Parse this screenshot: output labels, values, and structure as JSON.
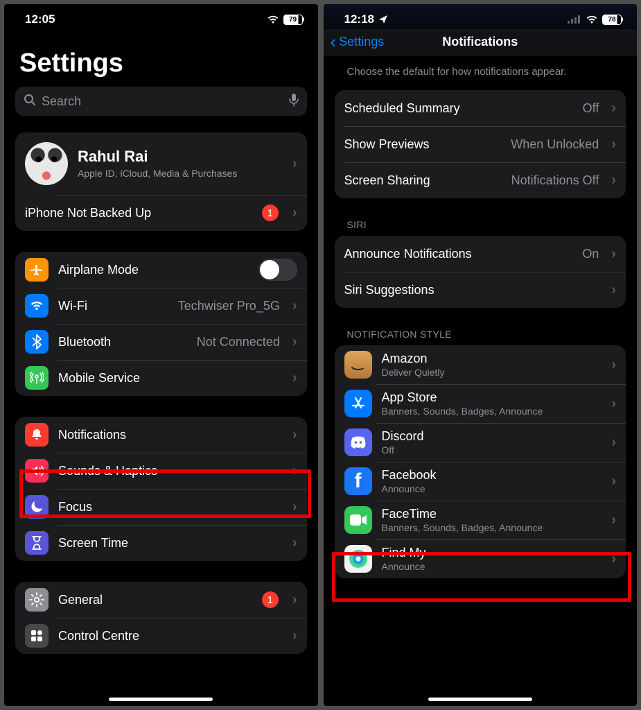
{
  "left": {
    "status": {
      "time": "12:05",
      "battery": "79"
    },
    "title": "Settings",
    "search_placeholder": "Search",
    "profile": {
      "name": "Rahul Rai",
      "subtitle": "Apple ID, iCloud, Media & Purchases"
    },
    "backup": {
      "label": "iPhone Not Backed Up",
      "badge": "1"
    },
    "group1": [
      {
        "icon": "airplane",
        "label": "Airplane Mode",
        "toggle": true
      },
      {
        "icon": "wifi",
        "label": "Wi-Fi",
        "detail": "Techwiser Pro_5G"
      },
      {
        "icon": "bluetooth",
        "label": "Bluetooth",
        "detail": "Not Connected"
      },
      {
        "icon": "antenna",
        "label": "Mobile Service",
        "detail": ""
      }
    ],
    "group2": [
      {
        "icon": "bell",
        "label": "Notifications"
      },
      {
        "icon": "speaker",
        "label": "Sounds & Haptics"
      },
      {
        "icon": "moon",
        "label": "Focus"
      },
      {
        "icon": "hourglass",
        "label": "Screen Time"
      }
    ],
    "group3": [
      {
        "icon": "gear",
        "label": "General",
        "badge": "1"
      },
      {
        "icon": "cc",
        "label": "Control Centre"
      }
    ]
  },
  "right": {
    "status": {
      "time": "12:18",
      "battery": "78"
    },
    "back": "Settings",
    "title": "Notifications",
    "desc": "Choose the default for how notifications appear.",
    "opts": [
      {
        "label": "Scheduled Summary",
        "detail": "Off"
      },
      {
        "label": "Show Previews",
        "detail": "When Unlocked"
      },
      {
        "label": "Screen Sharing",
        "detail": "Notifications Off"
      }
    ],
    "siri_header": "SIRI",
    "siri": [
      {
        "label": "Announce Notifications",
        "detail": "On"
      },
      {
        "label": "Siri Suggestions",
        "detail": ""
      }
    ],
    "style_header": "NOTIFICATION STYLE",
    "apps": [
      {
        "name": "Amazon",
        "sub": "Deliver Quietly",
        "bg": "bg-amazon",
        "glyph": ""
      },
      {
        "name": "App Store",
        "sub": "Banners, Sounds, Badges, Announce",
        "bg": "bg-blue",
        "glyph": "A"
      },
      {
        "name": "Discord",
        "sub": "Off",
        "bg": "bg-discord",
        "glyph": ""
      },
      {
        "name": "Facebook",
        "sub": "Announce",
        "bg": "bg-fb",
        "glyph": "f"
      },
      {
        "name": "FaceTime",
        "sub": "Banners, Sounds, Badges, Announce",
        "bg": "bg-ft",
        "glyph": ""
      },
      {
        "name": "Find My",
        "sub": "Announce",
        "bg": "bg-findmy",
        "glyph": ""
      }
    ]
  }
}
